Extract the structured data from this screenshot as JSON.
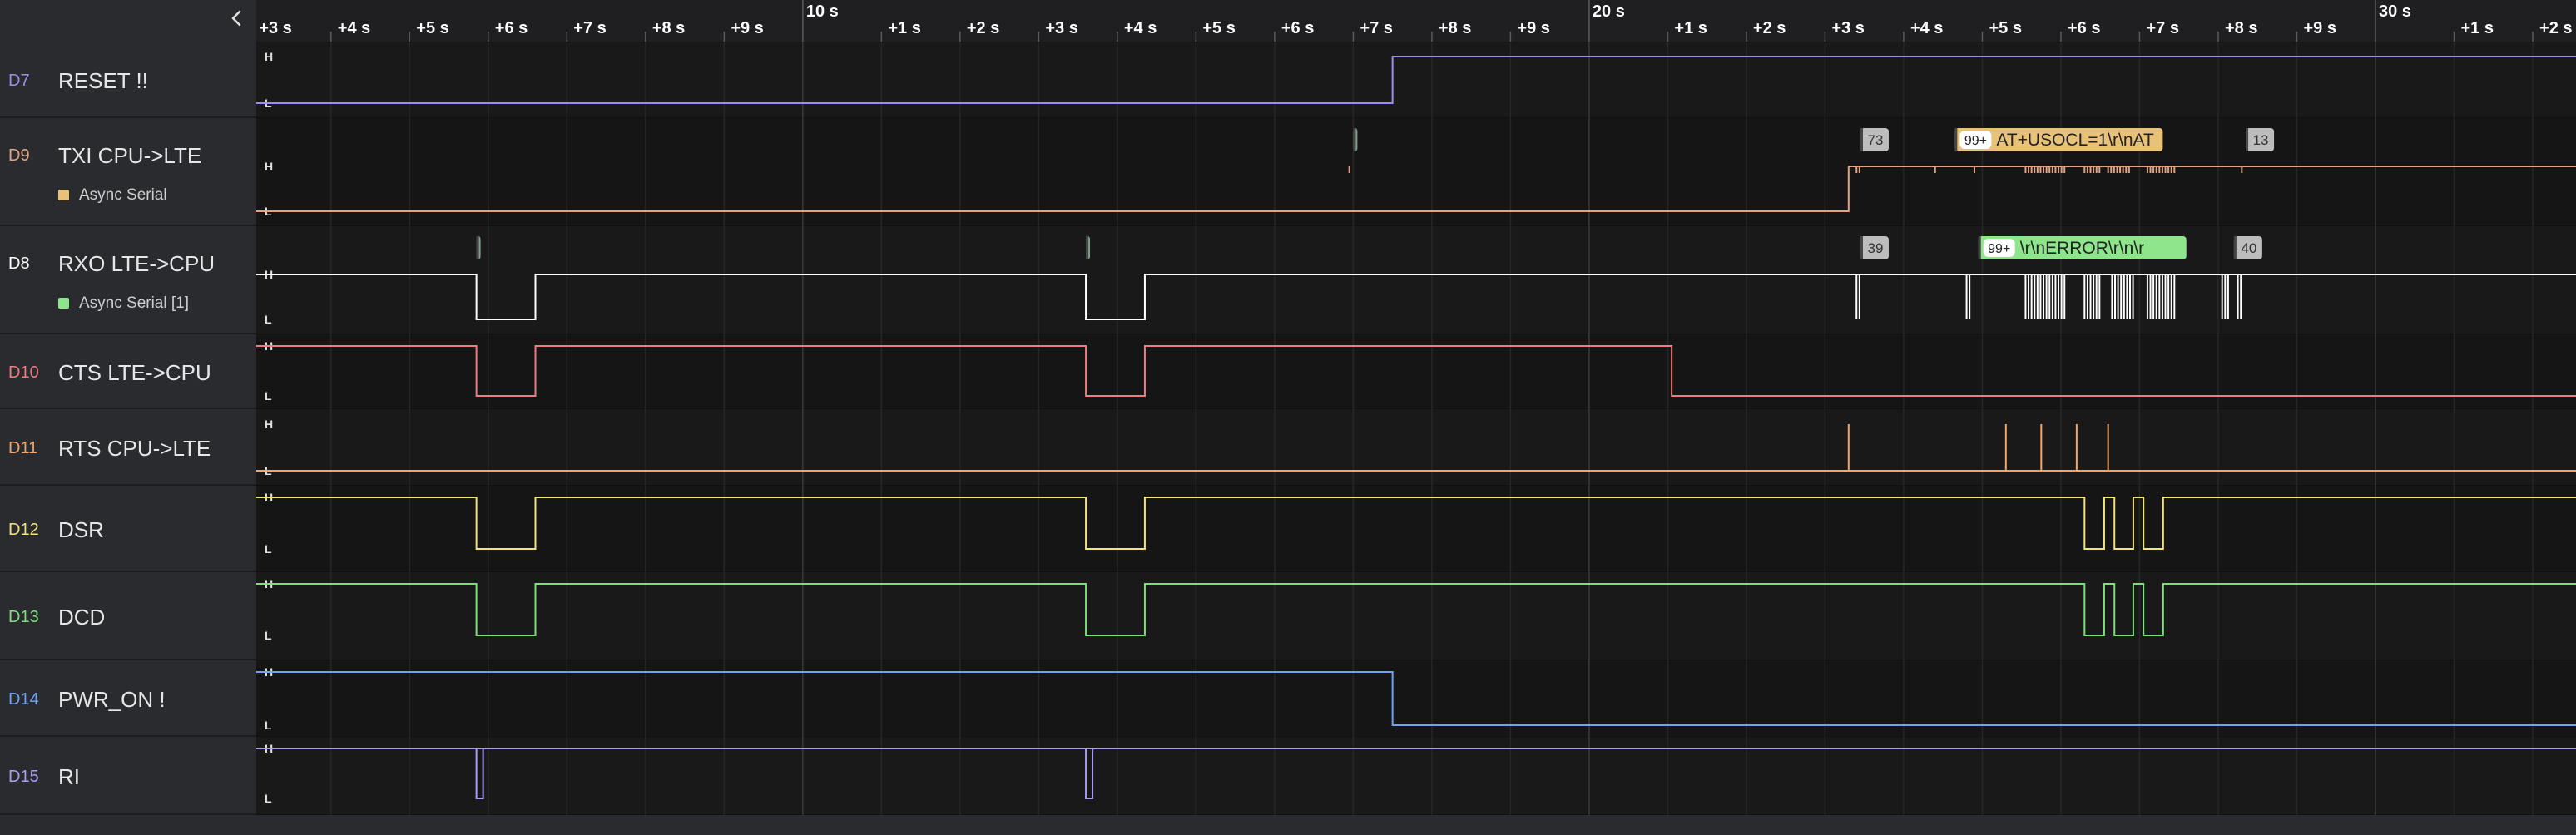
{
  "sidebar": {
    "collapse_icon": "chevron-left-icon",
    "channels": [
      {
        "id": "D7",
        "name": "RESET !!",
        "color": "#9b8cf2",
        "h": "H",
        "l": "L"
      },
      {
        "id": "D9",
        "name": "TXI CPU->LTE",
        "color": "#e0a484",
        "h": "H",
        "l": "L",
        "analyzer": {
          "label": "Async Serial",
          "color": "#e9c27a"
        }
      },
      {
        "id": "D8",
        "name": "RXO LTE->CPU",
        "color": "#ffffff",
        "h": "H",
        "l": "L",
        "analyzer": {
          "label": "Async Serial [1]",
          "color": "#8ee58c"
        }
      },
      {
        "id": "D10",
        "name": "CTS LTE->CPU",
        "color": "#f07a80",
        "h": "H",
        "l": "L"
      },
      {
        "id": "D11",
        "name": "RTS CPU->LTE",
        "color": "#f2a46a",
        "h": "H",
        "l": "L"
      },
      {
        "id": "D12",
        "name": "DSR",
        "color": "#f2e27a",
        "h": "H",
        "l": "L"
      },
      {
        "id": "D13",
        "name": "DCD",
        "color": "#7be07a",
        "h": "H",
        "l": "L"
      },
      {
        "id": "D14",
        "name": "PWR_ON !",
        "color": "#6fa2f2",
        "h": "H",
        "l": "L"
      },
      {
        "id": "D15",
        "name": "RI",
        "color": "#a89cf5",
        "h": "H",
        "l": "L"
      }
    ]
  },
  "ruler": {
    "ticks": [
      "+3 s",
      "+4 s",
      "+5 s",
      "+6 s",
      "+7 s",
      "+8 s",
      "+9 s",
      "10 s",
      "+1 s",
      "+2 s",
      "+3 s",
      "+4 s",
      "+5 s",
      "+6 s",
      "+7 s",
      "+8 s",
      "+9 s",
      "20 s",
      "+1 s",
      "+2 s",
      "+3 s",
      "+4 s",
      "+5 s",
      "+6 s",
      "+7 s",
      "+8 s",
      "+9 s",
      "30 s",
      "+1 s",
      "+2 s"
    ],
    "major_labels": [
      "10 s",
      "20 s",
      "30 s"
    ]
  },
  "timeline": {
    "t_start": 13.05,
    "t_end": 42.55,
    "note_units": "seconds"
  },
  "waveforms": {
    "D7": {
      "init": 0,
      "edges": [
        27.5
      ]
    },
    "D9": {
      "init": 0,
      "edges": [
        33.3
      ],
      "bursts": [
        [
          26.95,
          1
        ],
        [
          33.4,
          2
        ],
        [
          34.4,
          1
        ],
        [
          34.9,
          1
        ],
        [
          35.55,
          14
        ],
        [
          36.3,
          6
        ],
        [
          36.6,
          8
        ],
        [
          37.1,
          10
        ],
        [
          38.3,
          1
        ]
      ]
    },
    "D8": {
      "init": 1,
      "edges": [
        15.85,
        16.6,
        23.6,
        24.35
      ],
      "bursts": [
        [
          33.4,
          2
        ],
        [
          34.8,
          2
        ],
        [
          35.55,
          14
        ],
        [
          36.3,
          6
        ],
        [
          36.65,
          8
        ],
        [
          37.1,
          10
        ],
        [
          38.05,
          3
        ],
        [
          38.25,
          2
        ]
      ]
    },
    "D10": {
      "init": 1,
      "edges": [
        15.85,
        16.6,
        23.6,
        24.35,
        31.05
      ]
    },
    "D11": {
      "init": 0,
      "pulses": [
        33.3,
        35.3,
        35.75,
        36.2,
        36.6
      ]
    },
    "D12": {
      "init": 1,
      "edges": [
        15.85,
        16.6,
        23.6,
        24.35,
        36.3,
        36.55,
        36.68,
        36.92,
        37.05,
        37.3
      ]
    },
    "D13": {
      "init": 1,
      "edges": [
        15.85,
        16.6,
        23.6,
        24.35,
        36.3,
        36.55,
        36.68,
        36.92,
        37.05,
        37.3
      ]
    },
    "D14": {
      "init": 1,
      "edges": [
        27.5
      ]
    },
    "D15": {
      "init": 1,
      "neg_pulses": [
        15.85,
        23.6
      ]
    }
  },
  "decodes": {
    "D9": [
      {
        "t": 27.0,
        "text": "",
        "count": ""
      },
      {
        "t": 33.45,
        "text": "73",
        "count": ""
      },
      {
        "t": 34.65,
        "text": "AT+USOCL=1\\r\\nAT",
        "count": "99+"
      },
      {
        "t": 38.35,
        "text": "13",
        "count": ""
      }
    ],
    "D8": [
      {
        "t": 15.85,
        "text": "",
        "count": ""
      },
      {
        "t": 23.6,
        "text": "",
        "count": ""
      },
      {
        "t": 33.45,
        "text": "39",
        "count": ""
      },
      {
        "t": 34.95,
        "text": "\\r\\nERROR\\r\\n\\r",
        "count": "99+"
      },
      {
        "t": 38.2,
        "text": "40",
        "count": ""
      }
    ]
  },
  "colors": {
    "background": "#161616",
    "row_alt": "#1b1b1b",
    "grid": "#2c2c2c",
    "sidebar": "#2a2b2e",
    "ruler_text": "#ffffff",
    "d9_decode": "#e9c27a",
    "d8_decode": "#8ee58c",
    "grey_decode": "#bdbdbd"
  }
}
